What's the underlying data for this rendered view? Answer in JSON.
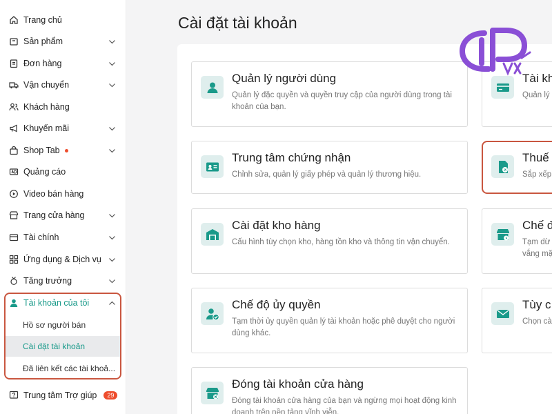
{
  "sidebar": {
    "items": [
      {
        "label": "Trang chủ"
      },
      {
        "label": "Sản phẩm"
      },
      {
        "label": "Đơn hàng"
      },
      {
        "label": "Vận chuyển"
      },
      {
        "label": "Khách hàng"
      },
      {
        "label": "Khuyến mãi"
      },
      {
        "label": "Shop Tab"
      },
      {
        "label": "Quảng cáo"
      },
      {
        "label": "Video bán hàng"
      },
      {
        "label": "Trang cửa hàng"
      },
      {
        "label": "Tài chính"
      },
      {
        "label": "Ứng dụng & Dịch vụ"
      },
      {
        "label": "Tăng trưởng"
      },
      {
        "label": "Tài khoản của tôi"
      }
    ],
    "account_sub": [
      {
        "label": "Hồ sơ người bán"
      },
      {
        "label": "Cài đặt tài khoản"
      },
      {
        "label": "Đã liên kết các tài khoả..."
      }
    ],
    "help": {
      "label": "Trung tâm Trợ giúp",
      "badge": "29"
    }
  },
  "main": {
    "title": "Cài đặt tài khoản",
    "cards_left": [
      {
        "title": "Quản lý người dùng",
        "desc": "Quản lý đặc quyền và quyền truy cập của người dùng trong tài khoản của bạn."
      },
      {
        "title": "Trung tâm chứng nhận",
        "desc": "Chỉnh sửa, quản lý giấy phép và quản lý thương hiệu."
      },
      {
        "title": "Cài đặt kho hàng",
        "desc": "Cấu hình tùy chọn kho, hàng tồn kho và thông tin vận chuyển."
      },
      {
        "title": "Chế độ ủy quyền",
        "desc": "Tạm thời ủy quyền quản lý tài khoản hoặc phê duyệt cho người dùng khác."
      },
      {
        "title": "Đóng tài khoản cửa hàng",
        "desc": "Đóng tài khoản cửa hàng của bạn và ngừng mọi hoạt động kinh doanh trên nền tảng vĩnh viễn."
      }
    ],
    "cards_right": [
      {
        "title": "Tài kh",
        "desc": "Quản lý"
      },
      {
        "title": "Thuế",
        "desc": "Sắp xếp"
      },
      {
        "title": "Chế đ",
        "desc": "Tạm dừ vắng mặ"
      },
      {
        "title": "Tùy c",
        "desc": "Chọn cà"
      }
    ]
  },
  "colors": {
    "accent": "#1a9a8a",
    "highlight": "#c9563f",
    "badge": "#ee4d2d",
    "logo": "#8a4fd6"
  }
}
